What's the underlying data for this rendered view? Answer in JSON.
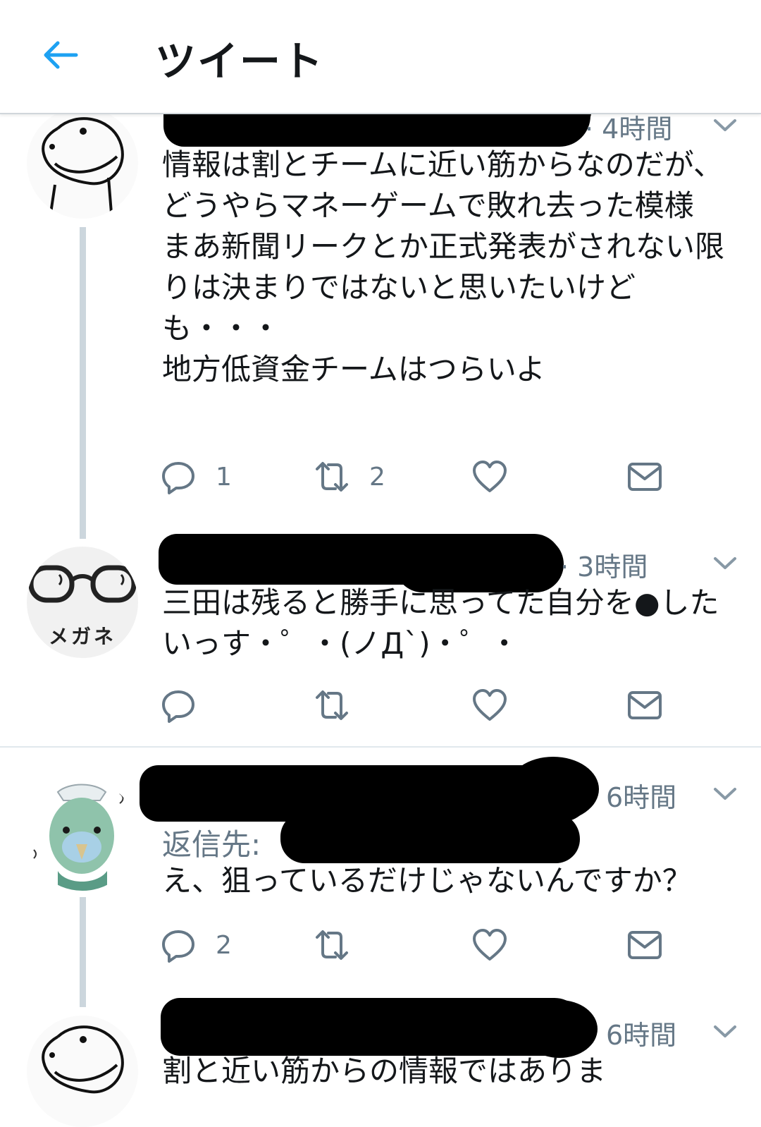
{
  "header": {
    "title": "ツイート"
  },
  "tweets": [
    {
      "time": "· 4時間",
      "text": "情報は割とチームに近い筋からなのだが、どうやらマネーゲームで敗れ去った模様\nまあ新聞リークとか正式発表がされない限りは決まりではないと思いたいけども・・・\n地方低資金チームはつらいよ",
      "reply_count": "1",
      "retweet_count": "2"
    },
    {
      "avatar_label": "メガネ",
      "time": "· 3時間",
      "text": "三田は残ると勝手に思ってた自分を●したいっす・゜・(ノД`)・゜・"
    },
    {
      "time": "6時間",
      "replying_label": "返信先:",
      "text": "え、狙っているだけじゃないんですか？",
      "reply_count": "2"
    },
    {
      "time": "6時間",
      "text": "割と近い筋からの情報ではありま"
    }
  ],
  "colors": {
    "accent": "#1da1f2",
    "muted": "#657786",
    "thread_line": "#ccd6dd"
  },
  "icons": [
    "back-arrow-icon",
    "reply-icon",
    "retweet-icon",
    "like-icon",
    "dm-icon",
    "chevron-down-icon"
  ]
}
